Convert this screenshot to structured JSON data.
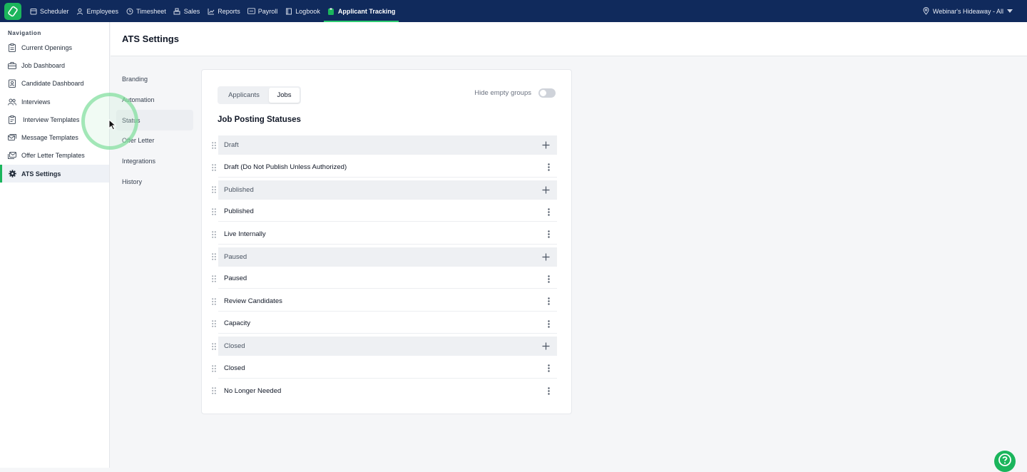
{
  "topnav": {
    "items": [
      {
        "label": "Scheduler",
        "icon": "calendar-icon"
      },
      {
        "label": "Employees",
        "icon": "person-icon"
      },
      {
        "label": "Timesheet",
        "icon": "clock-icon"
      },
      {
        "label": "Sales",
        "icon": "register-icon"
      },
      {
        "label": "Reports",
        "icon": "chart-icon"
      },
      {
        "label": "Payroll",
        "icon": "payroll-icon"
      },
      {
        "label": "Logbook",
        "icon": "book-icon"
      },
      {
        "label": "Applicant Tracking",
        "icon": "clipboard-icon",
        "active": true
      }
    ],
    "location": "Webinar's Hideaway - All"
  },
  "sidebar": {
    "heading": "Navigation",
    "items": [
      {
        "label": "Current Openings",
        "icon": "clipboard-list-icon"
      },
      {
        "label": "Job Dashboard",
        "icon": "briefcase-icon"
      },
      {
        "label": "Candidate Dashboard",
        "icon": "id-badge-icon"
      },
      {
        "label": "Interviews",
        "icon": "people-icon"
      },
      {
        "label": "Interview Templates",
        "icon": "clipboard-template-icon"
      },
      {
        "label": "Message Templates",
        "icon": "messages-icon"
      },
      {
        "label": "Offer Letter Templates",
        "icon": "letter-icon"
      },
      {
        "label": "ATS Settings",
        "icon": "gear-icon",
        "active": true
      }
    ]
  },
  "header": {
    "title": "ATS Settings"
  },
  "submenu": {
    "items": [
      "Branding",
      "Automation",
      "Status",
      "Offer Letter",
      "Integrations",
      "History"
    ],
    "active": "Status"
  },
  "card": {
    "tabs": [
      "Applicants",
      "Jobs"
    ],
    "active_tab": "Jobs",
    "hide_empty_label": "Hide empty groups",
    "hide_empty_on": false,
    "section_title": "Job Posting Statuses",
    "groups": [
      {
        "label": "Draft",
        "items": [
          "Draft (Do Not Publish Unless Authorized)"
        ]
      },
      {
        "label": "Published",
        "items": [
          "Published",
          "Live Internally"
        ]
      },
      {
        "label": "Paused",
        "items": [
          "Paused",
          "Review Candidates",
          "Capacity"
        ]
      },
      {
        "label": "Closed",
        "items": [
          "Closed",
          "No Longer Needed"
        ]
      }
    ]
  },
  "colors": {
    "navbar": "#102a5c",
    "accent": "#1bb55c"
  }
}
